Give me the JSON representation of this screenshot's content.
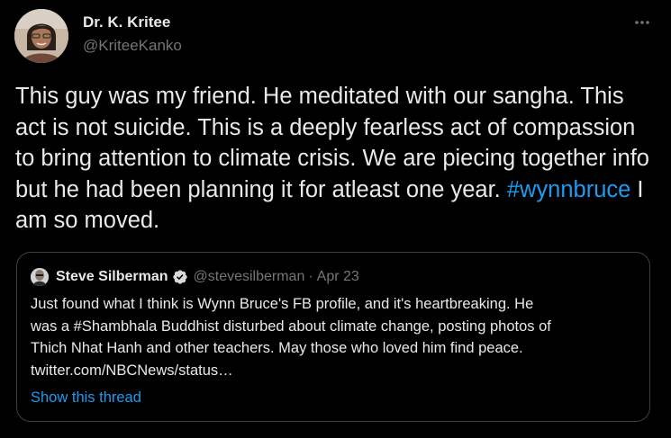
{
  "author": {
    "name": "Dr. K. Kritee",
    "handle": "@KriteeKanko",
    "avatar_icon": "profile-photo"
  },
  "more_icon": "more-horizontal-icon",
  "tweet": {
    "text": "This guy was my friend. He meditated with our sangha. This act is not suicide. This is a deeply fearless act of compassion to bring attention to climate crisis. We are piecing together info but he had been planning it for atleast one year. ",
    "hashtag": "#wynnbruce",
    "text_after": " I am so moved."
  },
  "quoted_tweet": {
    "author_name": "Steve Silberman",
    "author_handle": "@stevesilberman",
    "separator": "·",
    "date": "Apr 23",
    "verified_icon": "verified-badge-icon",
    "lines": [
      "Just found what I think is Wynn Bruce's FB profile, and it's heartbreaking. He",
      "was a #Shambhala Buddhist disturbed about climate change, posting photos of",
      "Thich Nhat Hanh and other teachers. May those who loved him find peace.",
      "twitter.com/NBCNews/status…"
    ],
    "show_thread": "Show this thread"
  },
  "colors": {
    "background": "#000000",
    "text": "#e7e9ea",
    "secondary": "#71767b",
    "link": "#1d9bf0",
    "border": "#3a3f44"
  }
}
